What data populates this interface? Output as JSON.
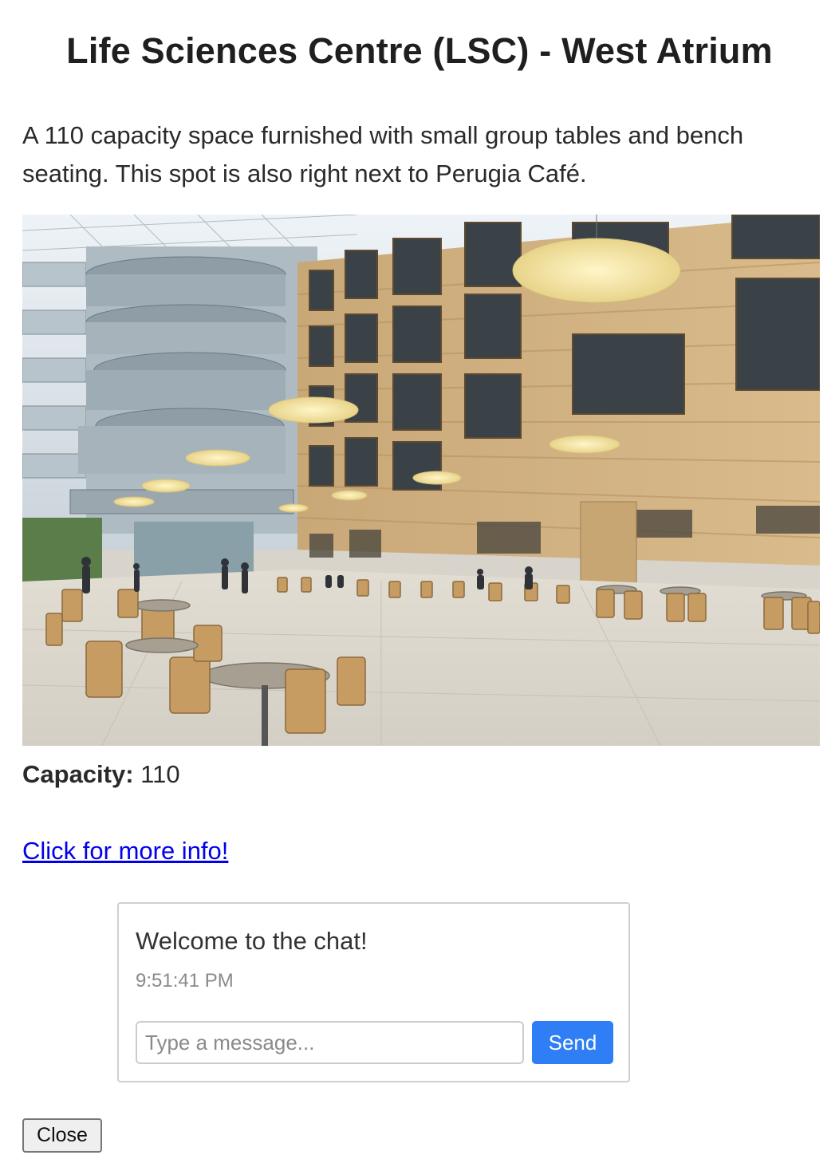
{
  "modal": {
    "title": "Life Sciences Centre (LSC) - West Atrium",
    "description": "A 110 capacity space furnished with small group tables and bench seating. This spot is also right next to Perugia Café.",
    "capacity_label": "Capacity:",
    "capacity_value": "110",
    "more_info_link": "Click for more info!",
    "close_label": "Close"
  },
  "chat": {
    "messages": [
      {
        "text": "Welcome to the chat!",
        "time": "9:51:41 PM"
      }
    ],
    "input_placeholder": "Type a message...",
    "input_value": "",
    "send_label": "Send"
  },
  "colors": {
    "link": "#0000ee",
    "send_button": "#2f7ef5",
    "chat_border": "#cfcfcf"
  }
}
